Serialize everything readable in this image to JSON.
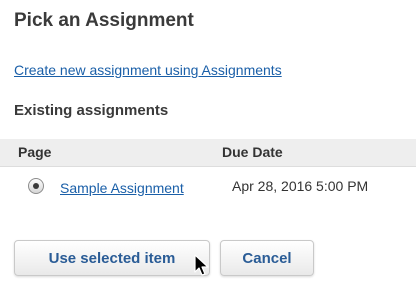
{
  "header": {
    "title": "Pick an Assignment"
  },
  "create_link": {
    "label": "Create new assignment using Assignments"
  },
  "existing": {
    "heading": "Existing assignments",
    "columns": {
      "page": "Page",
      "due_date": "Due Date"
    },
    "rows": [
      {
        "name": "Sample Assignment",
        "due_date": "Apr 28, 2016 5:00 PM",
        "selected": true
      }
    ]
  },
  "actions": {
    "use_selected_label": "Use selected item",
    "cancel_label": "Cancel"
  },
  "colors": {
    "link": "#1a5fa8",
    "button_text": "#2a5c96",
    "header_bg": "#eeeeee"
  },
  "icons": {
    "pointer": "mouse-pointer-icon",
    "radio": "radio-selected-icon"
  }
}
